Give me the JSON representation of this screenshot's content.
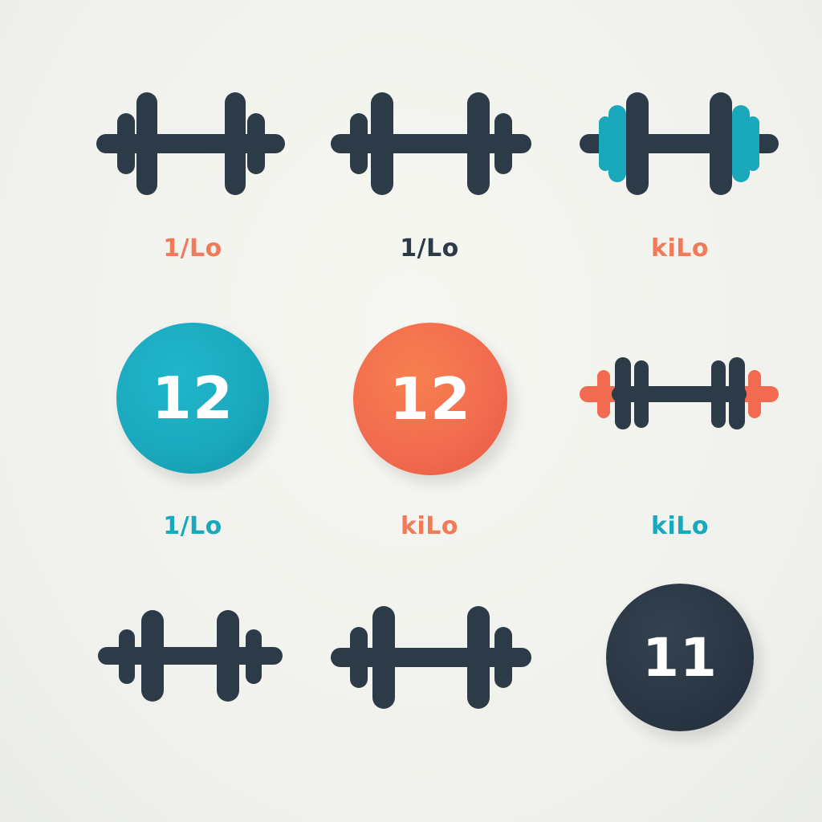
{
  "colors": {
    "dark": "#2d3a48",
    "teal": "#1aa8bd",
    "orange": "#f26a4f",
    "background": "#f3f4ef"
  },
  "items": [
    {
      "icon": "dumbbell-icon",
      "label": "1/Lo",
      "label_color": "#f07a5a"
    },
    {
      "icon": "dumbbell-icon",
      "label": "1/Lo",
      "label_color": "#2d3a48"
    },
    {
      "icon": "dumbbell-teal-plates-icon",
      "label": "kiLo",
      "label_color": "#f07a5a"
    },
    {
      "icon": "number-badge-teal",
      "badge_text": "12",
      "label": "1/Lo",
      "label_color": "#1aa8bd"
    },
    {
      "icon": "number-badge-orange",
      "badge_text": "12",
      "label": "kiLo",
      "label_color": "#f07a5a"
    },
    {
      "icon": "dumbbell-orange-plates-icon",
      "label": "kiLo",
      "label_color": "#1aa8bd"
    },
    {
      "icon": "dumbbell-icon"
    },
    {
      "icon": "dumbbell-icon"
    },
    {
      "icon": "number-badge-dark",
      "badge_text": "11"
    }
  ]
}
